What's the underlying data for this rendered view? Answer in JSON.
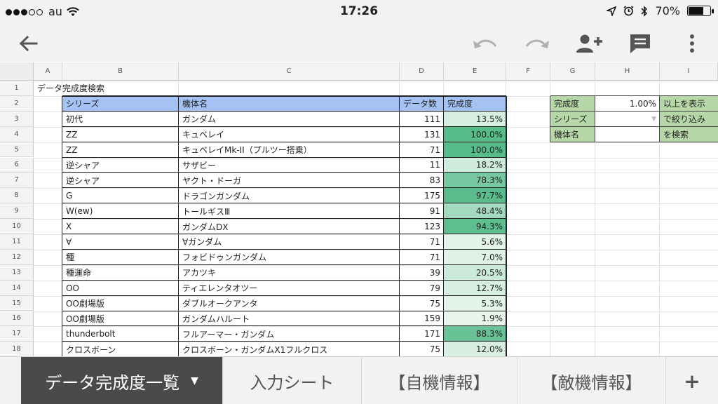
{
  "status_bar": {
    "carrier": "au",
    "time": "17:26",
    "battery": "70%",
    "battery_level": 0.7
  },
  "toolbar": {
    "icons": [
      "back-arrow-icon",
      "undo-icon",
      "redo-icon",
      "add-person-icon",
      "comment-icon",
      "more-vert-icon"
    ]
  },
  "columns": [
    "A",
    "B",
    "C",
    "D",
    "E",
    "F",
    "G",
    "H",
    "I"
  ],
  "row_numbers": [
    "1",
    "2",
    "3",
    "4",
    "5",
    "6",
    "7",
    "8",
    "9",
    "10",
    "11",
    "12",
    "13",
    "14",
    "15",
    "16",
    "17",
    "18"
  ],
  "sheet_title": "データ完成度検索",
  "table": {
    "headers": [
      "シリーズ",
      "機体名",
      "データ数",
      "完成度"
    ],
    "rows": [
      [
        "初代",
        "ガンダム",
        "111",
        "13.5%"
      ],
      [
        "ZZ",
        "キュベレイ",
        "131",
        "100.0%"
      ],
      [
        "ZZ",
        "キュベレイMk-II（プルツー搭乗）",
        "71",
        "100.0%"
      ],
      [
        "逆シャア",
        "サザビー",
        "11",
        "18.2%"
      ],
      [
        "逆シャア",
        "ヤクト・ドーガ",
        "83",
        "78.3%"
      ],
      [
        "G",
        "ドラゴンガンダム",
        "175",
        "97.7%"
      ],
      [
        "W(ew)",
        "トールギスⅢ",
        "91",
        "48.4%"
      ],
      [
        "X",
        "ガンダムDX",
        "123",
        "94.3%"
      ],
      [
        "∀",
        "∀ガンダム",
        "71",
        "5.6%"
      ],
      [
        "種",
        "フォビドゥンガンダム",
        "71",
        "7.0%"
      ],
      [
        "種運命",
        "アカツキ",
        "39",
        "20.5%"
      ],
      [
        "OO",
        "ティエレンタオツー",
        "79",
        "12.7%"
      ],
      [
        "OO劇場版",
        "ダブルオークアンタ",
        "75",
        "5.3%"
      ],
      [
        "OO劇場版",
        "ガンダムハルート",
        "159",
        "1.9%"
      ],
      [
        "thunderbolt",
        "フルアーマー・ガンダム",
        "171",
        "88.3%"
      ],
      [
        "クロスボーン",
        "クロスボーン・ガンダムX1フルクロス",
        "75",
        "12.0%"
      ]
    ],
    "completion_values": [
      0.135,
      1.0,
      1.0,
      0.182,
      0.783,
      0.977,
      0.484,
      0.943,
      0.056,
      0.07,
      0.205,
      0.127,
      0.053,
      0.019,
      0.883,
      0.12
    ]
  },
  "filter_panel": {
    "rows": [
      {
        "label": "完成度",
        "value": "1.00%",
        "suffix": "以上を表示"
      },
      {
        "label": "シリーズ",
        "value": "",
        "suffix": "で絞り込み"
      },
      {
        "label": "機体名",
        "value": "",
        "suffix": "を検索"
      }
    ]
  },
  "colors": {
    "header_blue": "#a4c2f4",
    "filter_green": "#b6d7a8",
    "scale_min": "#eaf6ee",
    "scale_max": "#57bb8a",
    "active_tab": "#4a4a4a"
  },
  "sheet_tabs": [
    {
      "label": "データ完成度一覧",
      "active": true
    },
    {
      "label": "入力シート",
      "active": false
    },
    {
      "label": "【自機情報】",
      "active": false
    },
    {
      "label": "【敵機情報】",
      "active": false
    }
  ],
  "add_sheet_label": "+"
}
